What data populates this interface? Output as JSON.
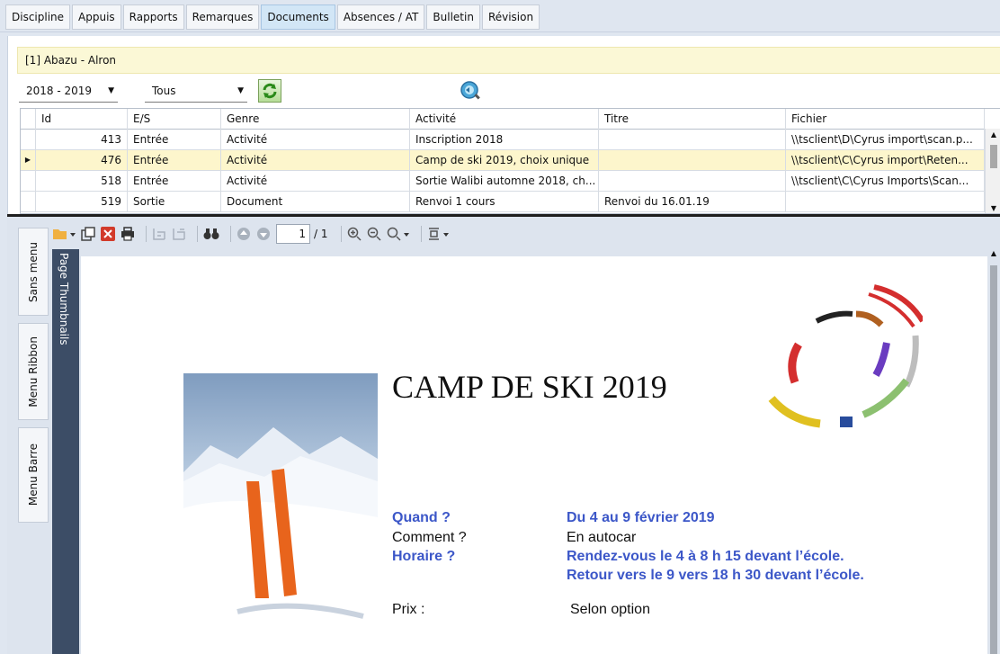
{
  "tabs": [
    "Discipline",
    "Appuis",
    "Rapports",
    "Remarques",
    "Documents",
    "Absences / AT",
    "Bulletin",
    "Révision"
  ],
  "student": "[1] Abazu - Alron",
  "year_select": "2018 - 2019",
  "filter_select": "Tous",
  "grid": {
    "headers": [
      "Id",
      "E/S",
      "Genre",
      "Activité",
      "Titre",
      "Fichier"
    ],
    "rows": [
      [
        "413",
        "Entrée",
        "Activité",
        "Inscription 2018",
        "",
        "\\\\tsclient\\D\\Cyrus import\\scan.p..."
      ],
      [
        "476",
        "Entrée",
        "Activité",
        "Camp de ski 2019, choix unique",
        "",
        "\\\\tsclient\\C\\Cyrus import\\Reten..."
      ],
      [
        "518",
        "Entrée",
        "Activité",
        "Sortie Walibi automne 2018, ch...",
        "",
        "\\\\tsclient\\C\\Cyrus Imports\\Scan..."
      ],
      [
        "519",
        "Sortie",
        "Document",
        "Renvoi 1 cours",
        "Renvoi du 16.01.19",
        ""
      ]
    ],
    "selected_row": 1
  },
  "side_tabs": [
    "Sans menu",
    "Menu Ribbon",
    "Menu Barre"
  ],
  "thumbnails_label": "Page Thumbnails",
  "pager": {
    "current": "1",
    "total": "/ 1"
  },
  "document": {
    "title": "CAMP DE SKI 2019",
    "quand_label": "Quand ?",
    "quand_value": "Du 4 au 9 février 2019",
    "comment_label": "Comment ?",
    "comment_value": "En autocar",
    "horaire_label": "Horaire ?",
    "horaire_line1": "Rendez-vous le 4  à 8 h 15 devant l’école.",
    "horaire_line2": "Retour vers le 9 vers 18 h 30 devant l’école.",
    "prix_label": "Prix :",
    "prix_value": "Selon option"
  },
  "colors": {
    "selected_tab": "#d2e6f6",
    "student_bar": "#fbf8d6",
    "doc_blue": "#3c57c8",
    "thumb_panel": "#3c4d66"
  }
}
